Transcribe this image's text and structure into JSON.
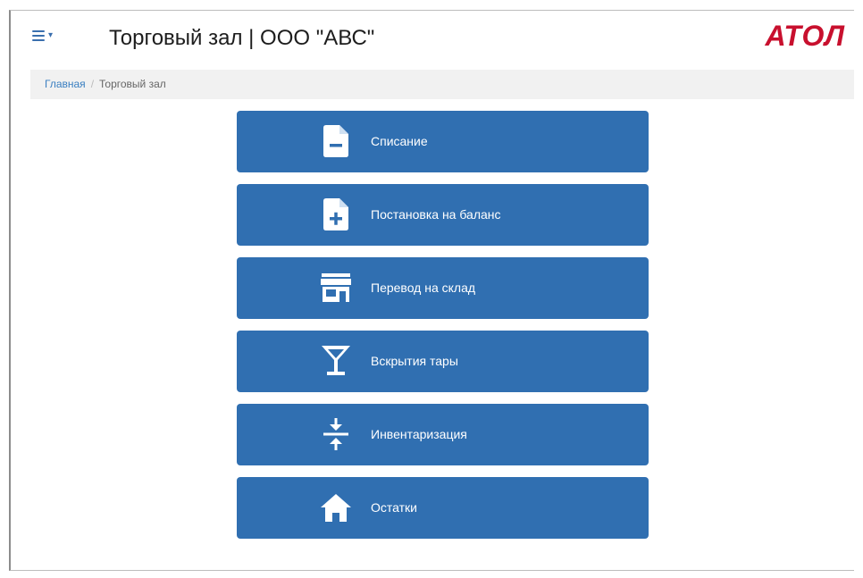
{
  "header": {
    "title": "Торговый зал | ООО \"АВС\"",
    "logo": "АТОЛ"
  },
  "breadcrumb": {
    "home": "Главная",
    "separator": "/",
    "current": "Торговый зал"
  },
  "actions": [
    {
      "label": "Списание",
      "icon": "file-minus-icon"
    },
    {
      "label": "Постановка на баланс",
      "icon": "file-plus-icon"
    },
    {
      "label": "Перевод на склад",
      "icon": "store-icon"
    },
    {
      "label": "Вскрытия тары",
      "icon": "cocktail-glass-icon"
    },
    {
      "label": "Инвентаризация",
      "icon": "compress-arrows-icon"
    },
    {
      "label": "Остатки",
      "icon": "home-icon"
    }
  ],
  "colors": {
    "button": "#306fb1",
    "logo": "#c8102e",
    "link": "#3a7fc1"
  }
}
